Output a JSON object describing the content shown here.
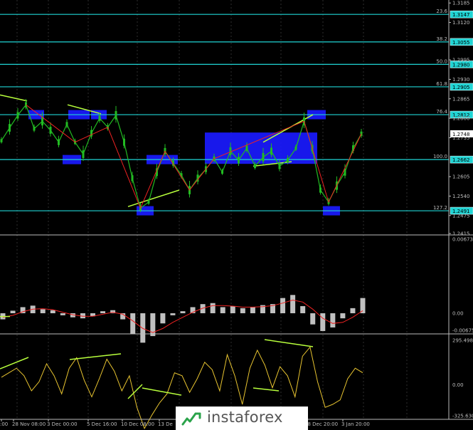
{
  "colors": {
    "background": "#000000",
    "grid": "#2e2e2e",
    "axis": "#bcbcbc",
    "fib": "#1fd4d4",
    "price": "#22bb22",
    "zigzag": "#ee2222",
    "trendline": "#b8ff3c",
    "zone": "#1a1aff",
    "macd_hist": "#c0c0c0",
    "macd_signal": "#ee2222",
    "cci": "#e8c430"
  },
  "price_axis": {
    "ticks": [
      "1.3185",
      "1.3120",
      "1.2995",
      "1.2930",
      "1.2865",
      "1.2800",
      "1.2735",
      "1.2605",
      "1.2540",
      "1.2475",
      "1.2415"
    ],
    "current_price": "1.2748"
  },
  "fib_levels": [
    {
      "label": "23.6",
      "price": "1.3147"
    },
    {
      "label": "38.2",
      "price": "1.3055"
    },
    {
      "label": "50.0",
      "price": "1.2980"
    },
    {
      "label": "61.8",
      "price": "1.2905"
    },
    {
      "label": "76.4",
      "price": "1.2812"
    },
    {
      "label": "100.0",
      "price": "1.2662"
    },
    {
      "label": "127.2",
      "price": "1.2491"
    }
  ],
  "macd_axis": [
    "0.00673",
    "0.00",
    "-0.00675"
  ],
  "cci_axis": [
    "295.4989",
    "0.00",
    "-325.6302"
  ],
  "x_labels": [
    ":00",
    "28 Nov 08:00",
    "3 Dec 00:00",
    "5 Dec 16:00",
    "10 Dec 08:00",
    "13 De",
    "28 Dec 20:00",
    "3 Jan 20:00"
  ],
  "logo_text": "instaforex",
  "chart_data": [
    {
      "type": "line",
      "series": [
        {
          "values": [
            1.2725,
            1.2768,
            1.281,
            1.2845,
            1.2765,
            1.279,
            1.276,
            1.272,
            1.278,
            1.272,
            1.268,
            1.275,
            1.28,
            1.277,
            1.281,
            1.272,
            1.26,
            1.25,
            1.252,
            1.262,
            1.269,
            1.265,
            1.261,
            1.256,
            1.26,
            1.263,
            1.2665,
            1.262,
            1.269,
            1.266,
            1.27,
            1.264,
            1.267,
            1.269,
            1.264,
            1.266,
            1.27,
            1.279,
            1.27,
            1.256,
            1.252,
            1.2575,
            1.262,
            1.27,
            1.2748
          ]
        }
      ],
      "ylim": [
        1.2415,
        1.3195
      ]
    },
    {
      "type": "bar",
      "series": [
        {
          "values": [
            -0.0012,
            0.0005,
            0.0012,
            0.0015,
            0.0008,
            0.0006,
            -0.0004,
            -0.0008,
            -0.001,
            -0.0006,
            0.0004,
            0.0006,
            -0.0012,
            -0.004,
            -0.0058,
            -0.0045,
            -0.002,
            -0.0004,
            0.0004,
            0.0012,
            0.0018,
            0.002,
            0.0012,
            0.0014,
            0.001,
            0.0012,
            0.0016,
            0.0018,
            0.003,
            0.0036,
            0.0014,
            -0.0022,
            -0.0035,
            -0.0028,
            -0.001,
            0.001,
            0.003
          ]
        },
        {
          "values": [
            -0.0008,
            -0.0004,
            0.0003,
            0.0008,
            0.0009,
            0.0007,
            0.0002,
            -0.0003,
            -0.0006,
            -0.0006,
            -0.0002,
            0.0002,
            -0.0002,
            -0.0015,
            -0.003,
            -0.0038,
            -0.003,
            -0.0018,
            -0.0008,
            0.0002,
            0.001,
            0.0015,
            0.0015,
            0.0014,
            0.0012,
            0.0012,
            0.0013,
            0.0015,
            0.002,
            0.0026,
            0.0022,
            0.0008,
            -0.001,
            -0.002,
            -0.0018,
            -0.0008,
            0.0005
          ]
        }
      ],
      "ylim": [
        -0.00675,
        0.00673
      ]
    },
    {
      "type": "line",
      "series": [
        {
          "values": [
            50,
            80,
            110,
            60,
            -40,
            20,
            140,
            60,
            -60,
            110,
            180,
            30,
            -80,
            40,
            170,
            90,
            -40,
            60,
            -150,
            -290,
            -200,
            -120,
            -60,
            80,
            60,
            -50,
            40,
            150,
            100,
            -40,
            200,
            60,
            -130,
            110,
            230,
            130,
            -20,
            120,
            60,
            -80,
            190,
            250,
            20,
            -150,
            -130,
            -100,
            40,
            110,
            80
          ]
        }
      ],
      "ylim": [
        -325.6302,
        295.4989
      ]
    }
  ]
}
